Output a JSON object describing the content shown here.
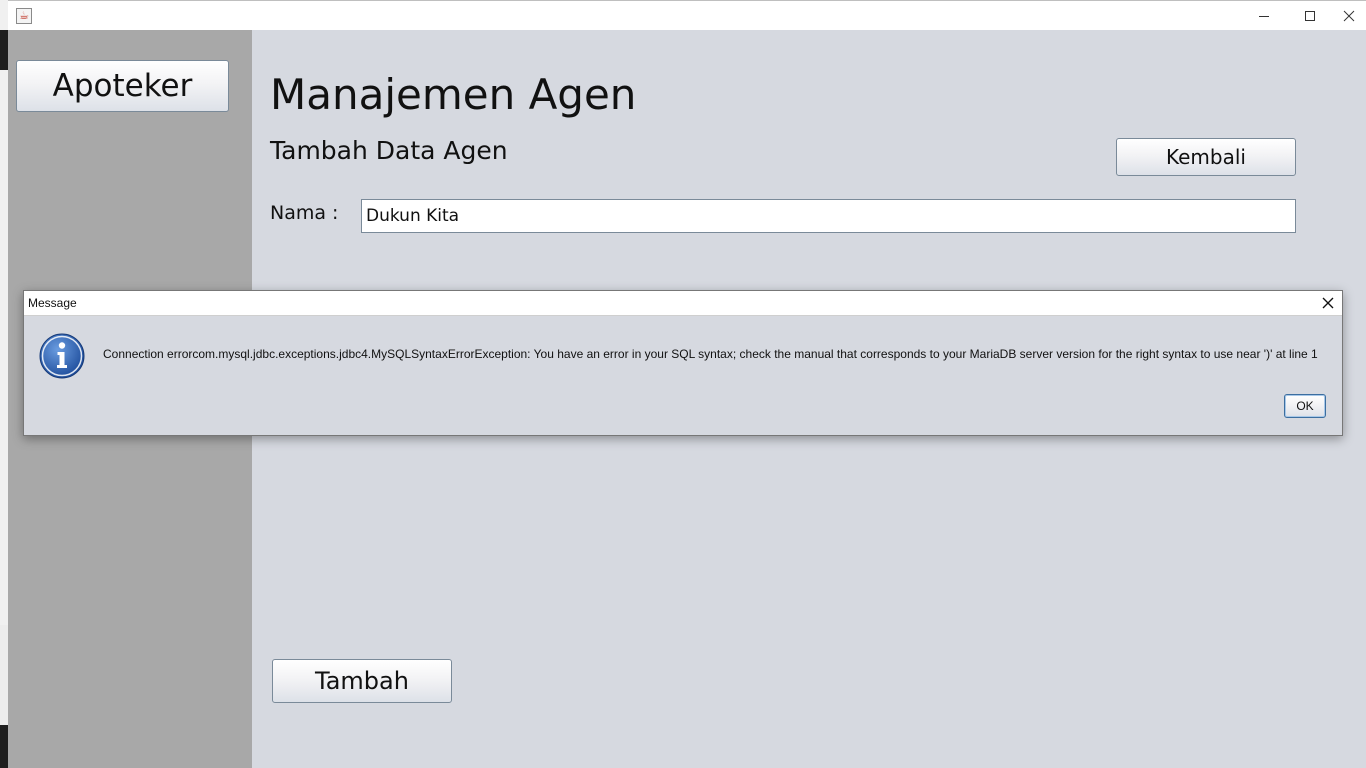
{
  "window": {
    "app_icon": "java-icon",
    "controls": {
      "minimize_icon": "minimize-icon",
      "maximize_icon": "maximize-icon",
      "close_icon": "close-icon"
    }
  },
  "sidebar": {
    "apoteker_label": "Apoteker"
  },
  "main": {
    "title": "Manajemen Agen",
    "subtitle": "Tambah Data Agen",
    "back_label": "Kembali",
    "nama_label": "Nama :",
    "nama_value": "Dukun Kita",
    "add_label": "Tambah"
  },
  "dialog": {
    "title": "Message",
    "icon": "info-icon",
    "message": "Connection errorcom.mysql.jdbc.exceptions.jdbc4.MySQLSyntaxErrorException: You have an error in your SQL syntax; check the manual that corresponds to your MariaDB server version for the right syntax to use near ')' at line 1",
    "ok_label": "OK",
    "info_color": "#2a5db0"
  }
}
